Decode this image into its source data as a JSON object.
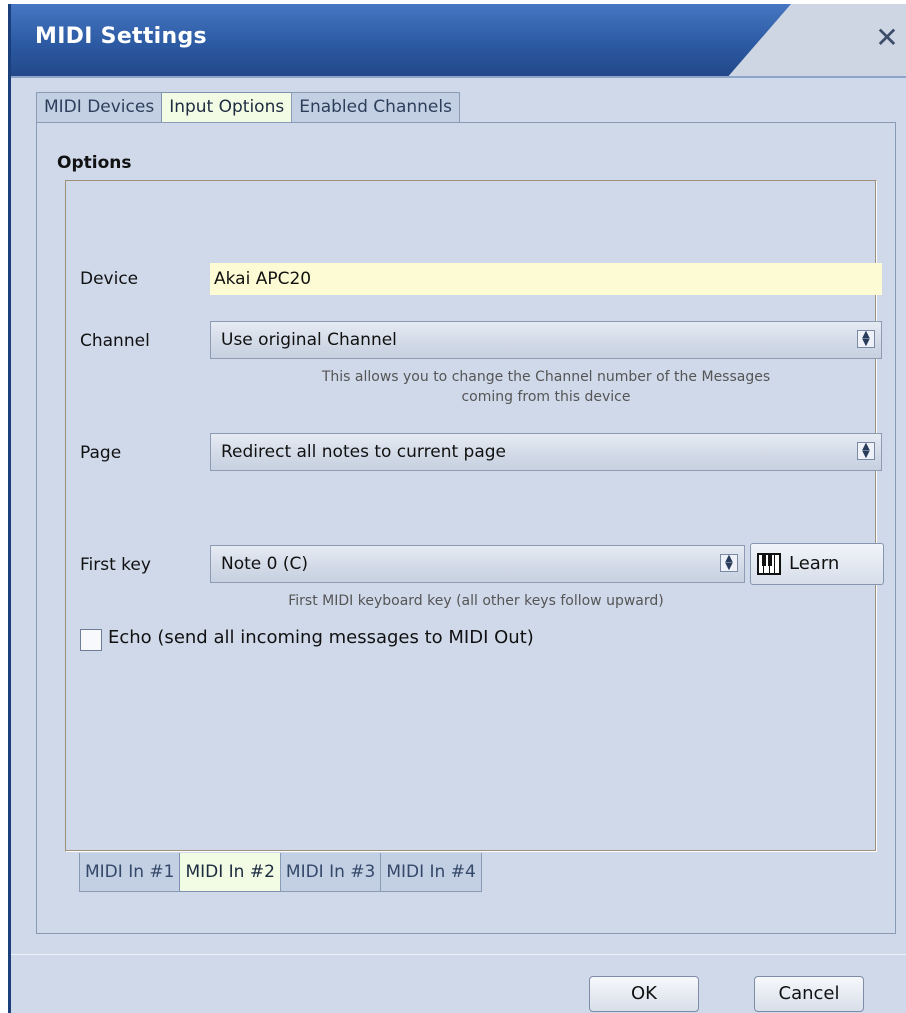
{
  "window": {
    "title": "MIDI Settings",
    "close_glyph": "✕"
  },
  "tabs": [
    {
      "label": "MIDI Devices",
      "active": false
    },
    {
      "label": "Input Options",
      "active": true
    },
    {
      "label": "Enabled Channels",
      "active": false
    }
  ],
  "options": {
    "group_title": "Options",
    "device": {
      "label": "Device",
      "value": "Akai APC20"
    },
    "channel": {
      "label": "Channel",
      "selected": "Use original Channel",
      "hint_line1": "This allows you to change the Channel number of the Messages",
      "hint_line2": "coming from this device"
    },
    "page": {
      "label": "Page",
      "selected": "Redirect all notes to current page"
    },
    "first_key": {
      "label": "First key",
      "selected": "Note 0 (C)",
      "learn_label": "Learn",
      "learn_icon": "piano-keyboard-icon",
      "hint": "First MIDI keyboard key (all other keys follow upward)"
    },
    "echo": {
      "label": "Echo (send all incoming messages to MIDI Out)",
      "checked": false
    }
  },
  "input_tabs": [
    {
      "label": "MIDI In #1",
      "active": false
    },
    {
      "label": "MIDI In #2",
      "active": true
    },
    {
      "label": "MIDI In #3",
      "active": false
    },
    {
      "label": "MIDI In #4",
      "active": false
    }
  ],
  "buttons": {
    "ok": "OK",
    "cancel": "Cancel"
  }
}
